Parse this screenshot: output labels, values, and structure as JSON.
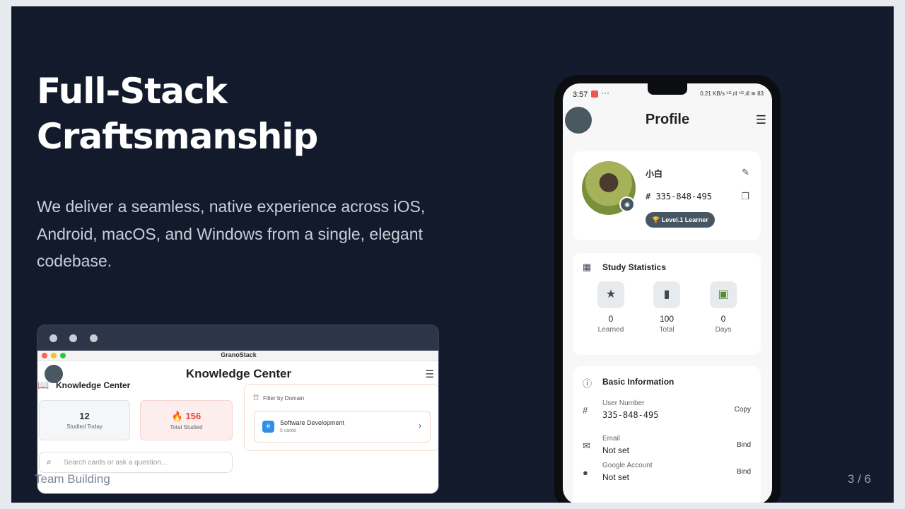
{
  "slide": {
    "title_line1": "Full-Stack",
    "title_line2": "Craftsmanship",
    "subtitle": "We deliver a seamless, native experience across iOS, Android, macOS, and Windows from a single, elegant codebase.",
    "footer_left": "Team Building",
    "page_indicator": "3 / 6"
  },
  "desktop_app": {
    "window_title": "GranoStack",
    "header_title": "Knowledge Center",
    "section_title": "Knowledge Center",
    "stats": [
      {
        "value": "12",
        "label": "Studied Today"
      },
      {
        "value": "🔥 156",
        "label": "Total Studied"
      }
    ],
    "search_placeholder": "Search cards or ask a question...",
    "filter_label": "Filter by Domain",
    "domain": {
      "name": "Software Development",
      "count": "5 cards"
    }
  },
  "phone_app": {
    "status_time": "3:57",
    "status_right": "0.21 KB/s  ⁵ᴳ.ıll ⁵ᴳ.ıll  ≋  83",
    "title": "Profile",
    "user": {
      "name": "小白",
      "id": "335-848-495",
      "badge": "🏆 Level.1 Learner"
    },
    "study_stats": {
      "title": "Study Statistics",
      "items": [
        {
          "icon": "star-icon",
          "value": "0",
          "label": "Learned"
        },
        {
          "icon": "book-icon",
          "value": "100",
          "label": "Total"
        },
        {
          "icon": "calendar-icon",
          "value": "0",
          "label": "Days"
        }
      ]
    },
    "basic_info": {
      "title": "Basic Information",
      "rows": [
        {
          "label": "User Number",
          "value": "335-848-495",
          "action": "Copy"
        },
        {
          "label": "Email",
          "value": "Not set",
          "action": "Bind"
        },
        {
          "label": "Google Account",
          "value": "Not set",
          "action": "Bind"
        }
      ]
    }
  },
  "colors": {
    "slide_bg": "#131a2b",
    "accent_slate": "#475663",
    "fire_red": "#e5483b"
  }
}
